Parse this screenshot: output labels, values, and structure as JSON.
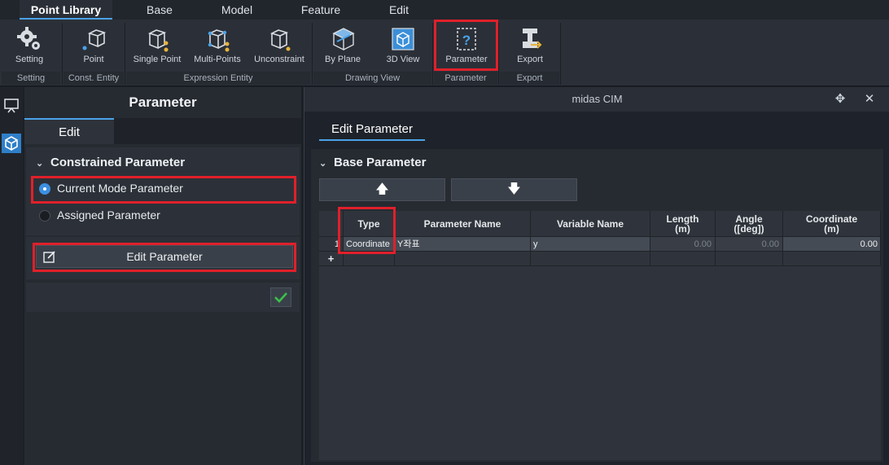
{
  "menu": {
    "tabs": [
      {
        "label": "Point Library"
      },
      {
        "label": "Base"
      },
      {
        "label": "Model"
      },
      {
        "label": "Feature"
      },
      {
        "label": "Edit"
      }
    ]
  },
  "ribbon": {
    "buttons": [
      {
        "label": "Setting",
        "icon": "gear-icon"
      },
      {
        "label": "Point",
        "icon": "point-icon"
      },
      {
        "label": "Single Point",
        "icon": "single-point-icon"
      },
      {
        "label": "Multi-Points",
        "icon": "multi-points-icon"
      },
      {
        "label": "Unconstraint",
        "icon": "unconstraint-icon"
      },
      {
        "label": "By Plane",
        "icon": "by-plane-icon"
      },
      {
        "label": "3D View",
        "icon": "3d-view-icon"
      },
      {
        "label": "Parameter",
        "icon": "parameter-icon"
      },
      {
        "label": "Export",
        "icon": "export-icon"
      }
    ],
    "groups": [
      {
        "label": "Setting"
      },
      {
        "label": "Const. Entity"
      },
      {
        "label": "Expression Entity"
      },
      {
        "label": "Drawing View"
      },
      {
        "label": "Parameter"
      },
      {
        "label": "Export"
      }
    ]
  },
  "panel": {
    "title": "Parameter",
    "tab": "Edit",
    "section_title": "Constrained Parameter",
    "radio_current": "Current Mode Parameter",
    "radio_assigned": "Assigned Parameter",
    "selected": "Current Mode Parameter",
    "edit_button": "Edit Parameter"
  },
  "dialog": {
    "title": "midas CIM",
    "tab": "Edit Parameter",
    "section_title": "Base Parameter",
    "up_arrow": "🡅",
    "down_arrow": "🡇",
    "columns": [
      "Type",
      "Parameter Name",
      "Variable Name",
      "Length\n(m)",
      "Angle\n([deg])",
      "Coordinate\n(m)"
    ],
    "rows": [
      {
        "index": "1",
        "type": "Coordinate",
        "parameter_name": "Y좌표",
        "variable_name": "y",
        "length": "0.00",
        "angle": "0.00",
        "coordinate": "0.00"
      }
    ],
    "add_row_symbol": "+"
  },
  "colors": {
    "accent": "#4aa3e8",
    "highlight": "#e0202a",
    "confirm": "#39c24a"
  }
}
